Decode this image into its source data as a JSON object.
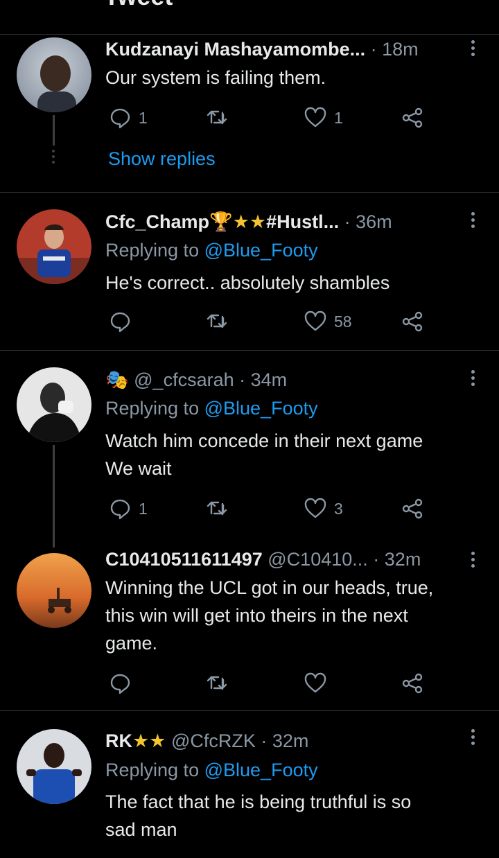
{
  "header": {
    "title": "Tweet"
  },
  "tweets": [
    {
      "name": "Kudzanayi Mashayamombe...",
      "handle": "",
      "time": "18m",
      "reply_to_label": "",
      "reply_to_user": "",
      "text": "Our system is failing them.",
      "replies": "1",
      "retweets": "",
      "likes": "1",
      "show_replies": "Show replies"
    },
    {
      "name": "Cfc_Champ",
      "name_suffix": "#Hustl...",
      "handle": "",
      "time": "36m",
      "reply_to_label": "Replying to",
      "reply_to_user": "@Blue_Footy",
      "text": "He's correct.. absolutely shambles",
      "replies": "",
      "retweets": "",
      "likes": "58"
    },
    {
      "name": "",
      "handle": "@_cfcsarah",
      "time": "34m",
      "reply_to_label": "Replying to",
      "reply_to_user": "@Blue_Footy",
      "text_line1": "Watch him concede in their next game",
      "text_line2": "We wait",
      "replies": "1",
      "retweets": "",
      "likes": "3"
    },
    {
      "name": "C10410511611497",
      "handle": "@C10410...",
      "time": "32m",
      "text_line1": "Winning the UCL got in our heads, true,",
      "text_line2": "this win will get into theirs in the next",
      "text_line3": "game.",
      "replies": "",
      "retweets": "",
      "likes": ""
    },
    {
      "name": "RK",
      "handle": "@CfcRZK",
      "time": "32m",
      "reply_to_label": "Replying to",
      "reply_to_user": "@Blue_Footy",
      "text_line1": "The fact that he is being truthful is so",
      "text_line2": "sad man"
    }
  ],
  "colors": {
    "accent": "#1d9bf0",
    "muted": "#8b98a5",
    "divider": "#2f3336",
    "background": "#000000"
  }
}
